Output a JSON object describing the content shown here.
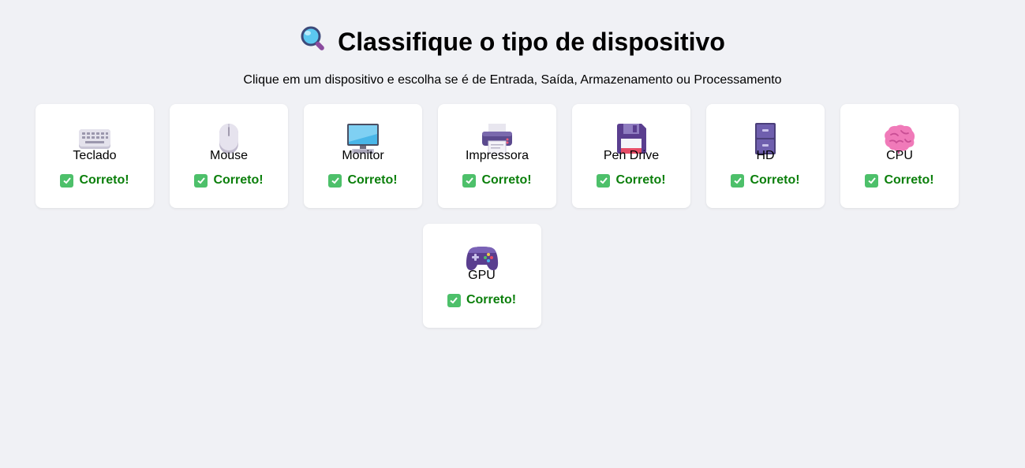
{
  "header": {
    "title": "Classifique o tipo de dispositivo",
    "subtitle": "Clique em um dispositivo e escolha se é de Entrada, Saída, Armazenamento ou Processamento",
    "icon": "magnifier-icon"
  },
  "devices": [
    {
      "name": "Teclado",
      "icon": "keyboard-icon",
      "status": "Correto!"
    },
    {
      "name": "Mouse",
      "icon": "mouse-icon",
      "status": "Correto!"
    },
    {
      "name": "Monitor",
      "icon": "monitor-icon",
      "status": "Correto!"
    },
    {
      "name": "Impressora",
      "icon": "printer-icon",
      "status": "Correto!"
    },
    {
      "name": "Pen Drive",
      "icon": "floppy-disk-icon",
      "status": "Correto!"
    },
    {
      "name": "HD",
      "icon": "file-cabinet-icon",
      "status": "Correto!"
    },
    {
      "name": "CPU",
      "icon": "brain-icon",
      "status": "Correto!"
    },
    {
      "name": "GPU",
      "icon": "gamepad-icon",
      "status": "Correto!"
    }
  ],
  "colors": {
    "background": "#f0f1f5",
    "card": "#ffffff",
    "correct_text": "#0b7f0b",
    "check_bg": "#4dc06a"
  }
}
